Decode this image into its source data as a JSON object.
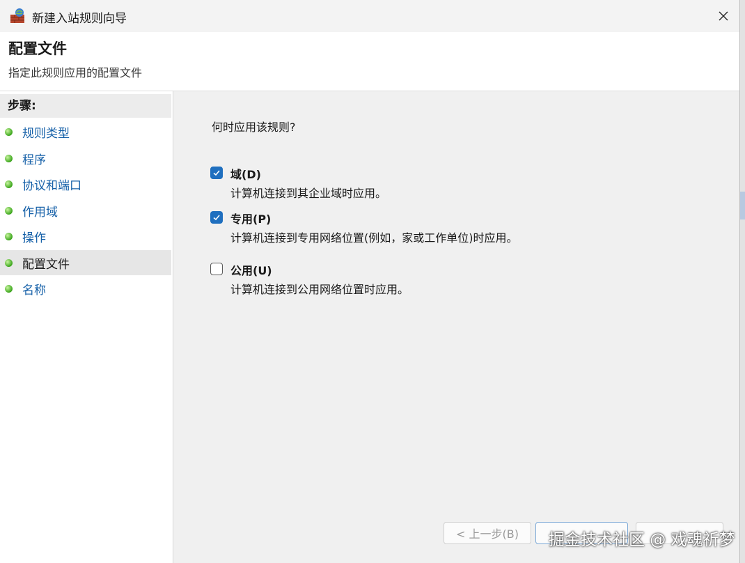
{
  "window": {
    "title": "新建入站规则向导",
    "close_icon": "close-icon",
    "app_icon": "firewall-icon"
  },
  "header": {
    "title": "配置文件",
    "subtitle": "指定此规则应用的配置文件"
  },
  "sidebar": {
    "heading": "步骤:",
    "items": [
      {
        "label": "规则类型",
        "active": false
      },
      {
        "label": "程序",
        "active": false
      },
      {
        "label": "协议和端口",
        "active": false
      },
      {
        "label": "作用域",
        "active": false
      },
      {
        "label": "操作",
        "active": false
      },
      {
        "label": "配置文件",
        "active": true
      },
      {
        "label": "名称",
        "active": false
      }
    ]
  },
  "main": {
    "question": "何时应用该规则?",
    "options": [
      {
        "label": "域(D)",
        "description": "计算机连接到其企业域时应用。",
        "checked": true
      },
      {
        "label": "专用(P)",
        "description": "计算机连接到专用网络位置(例如，家或工作单位)时应用。",
        "checked": true
      },
      {
        "label": "公用(U)",
        "description": "计算机连接到公用网络位置时应用。",
        "checked": false
      }
    ]
  },
  "buttons": {
    "back": "< 上一步(B)"
  },
  "watermark": "掘金技术社区 @ 戏魂祈梦",
  "colors": {
    "accent": "#1f6fbf",
    "link": "#1560a8",
    "step_dot": "#3aa51a"
  }
}
